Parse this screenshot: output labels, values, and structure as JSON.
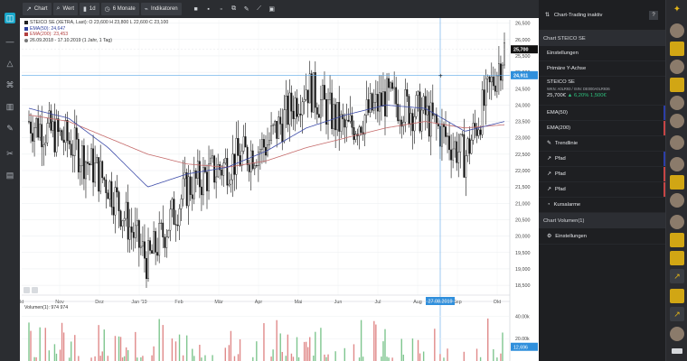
{
  "toolbar": {
    "chart_label": "Chart",
    "wert_label": "Wert",
    "interval_label": "1d",
    "range_label": "6 Monate",
    "indicators_label": "Indikatoren"
  },
  "legend": {
    "quote_line": "STEICO SE (XETRA, Last): O 23,600 H 23,800 L 22,600 C 23,100",
    "ema50_line": "EMA(50): 24,647",
    "ema200_line": "EMA(200): 23,453",
    "date_line": "26.09.2018 - 17.10.2019  (1 Jahr, 1 Tag)"
  },
  "chart": {
    "crosshair_date_label": "27.08.2019",
    "last_price_label": "25,700",
    "crosshair_price_label": "24,911",
    "volume_label": "Volumen(1): 974  974",
    "volume_ticks": [
      "40.00k",
      "20.00k"
    ],
    "volume_tag": "12,696"
  },
  "right_panel": {
    "header_label": "Chart-Trading inaktiv",
    "help_label": "?",
    "section1_title": "Chart STEICO SE",
    "items": [
      "Einstellungen",
      "Primäre Y-Achse"
    ],
    "stock": {
      "name": "STEICO SE",
      "wkn_line": "WKN: A0LR93 / ISIN: DE000A0LR936",
      "price": "25,700€",
      "change": "▲ 6,20%   1,500€"
    },
    "indicators": [
      "EMA(50)",
      "EMA(200)"
    ],
    "tools": [
      "Trendlinie",
      "Pfad",
      "Pfad",
      "Pfad",
      "Kursalarme"
    ],
    "section2_title": "Chart Volumen(1)",
    "section2_items": [
      "Einstellungen"
    ]
  },
  "chart_data": {
    "type": "candlestick",
    "title": "STEICO SE (XETRA, Last)",
    "x_tick_labels": [
      "Okt",
      "Nov",
      "Dez",
      "Jan '19",
      "Feb",
      "Mär",
      "Apr",
      "Mai",
      "Jun",
      "Jul",
      "Aug",
      "Sep",
      "Okt"
    ],
    "y_ticks": [
      18.5,
      19.0,
      19.5,
      20.0,
      20.5,
      21.0,
      21.5,
      22.0,
      22.5,
      23.0,
      23.5,
      24.0,
      24.5,
      25.0,
      25.5,
      26.0,
      26.5
    ],
    "ylim": [
      18.2,
      26.6
    ],
    "x": [
      "2018-10",
      "2018-11",
      "2018-12",
      "2019-01",
      "2019-02",
      "2019-03",
      "2019-04",
      "2019-05",
      "2019-06",
      "2019-07",
      "2019-08",
      "2019-09",
      "2019-10"
    ],
    "price_path": [
      23.5,
      22.9,
      21.6,
      19.2,
      21.5,
      22.2,
      22.8,
      24.6,
      23.2,
      24.2,
      23.7,
      22.4,
      25.7
    ],
    "ema50": [
      23.9,
      23.6,
      22.7,
      21.5,
      21.9,
      22.1,
      22.6,
      23.3,
      23.7,
      24.0,
      23.9,
      23.2,
      23.5
    ],
    "ema200": [
      23.7,
      23.5,
      23.0,
      22.5,
      22.2,
      22.1,
      22.3,
      22.7,
      23.0,
      23.3,
      23.5,
      23.3,
      23.4
    ],
    "last_price": 25.7,
    "crosshair_price": 24.911,
    "crosshair_date": "27.08.2019",
    "volume_ticks": [
      40000,
      20000
    ],
    "grid": true
  }
}
